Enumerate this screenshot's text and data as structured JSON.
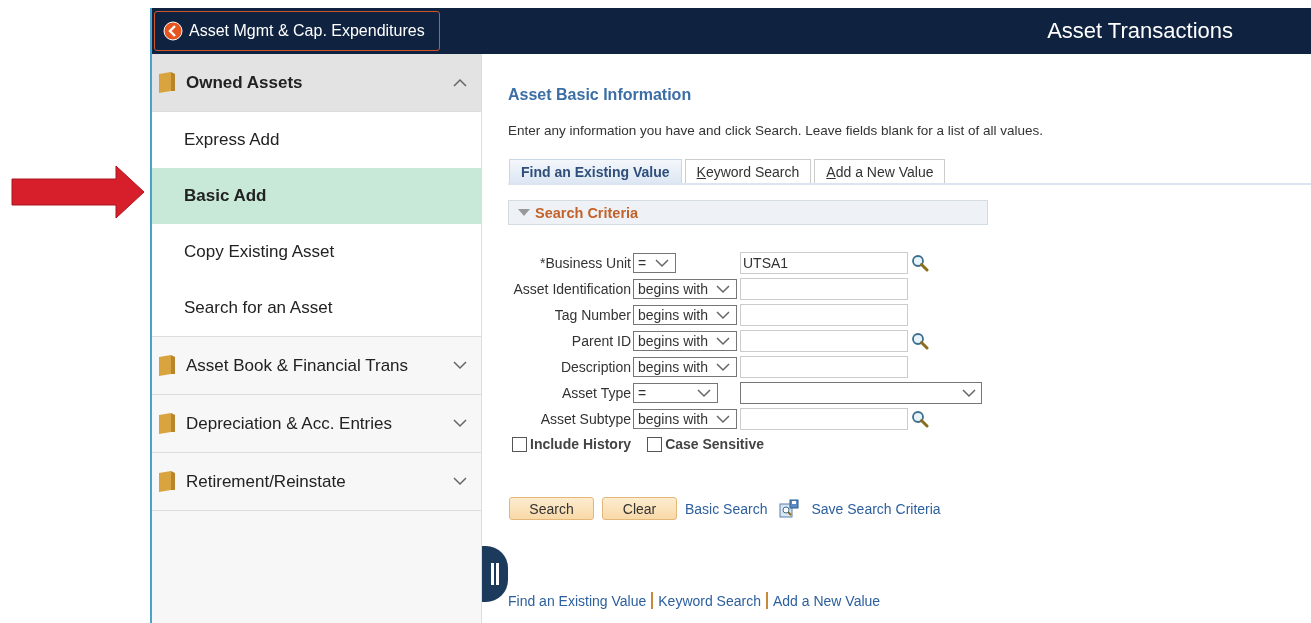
{
  "header": {
    "back_button": "Asset Mgmt & Cap. Expenditures",
    "title": "Asset Transactions"
  },
  "sidebar": {
    "groups": [
      {
        "label": "Owned Assets",
        "expanded": true,
        "items": [
          {
            "label": "Express Add",
            "selected": false
          },
          {
            "label": "Basic Add",
            "selected": true
          },
          {
            "label": "Copy Existing Asset",
            "selected": false
          },
          {
            "label": "Search for an Asset",
            "selected": false
          }
        ]
      },
      {
        "label": "Asset Book & Financial Trans",
        "expanded": false
      },
      {
        "label": "Depreciation & Acc. Entries",
        "expanded": false
      },
      {
        "label": "Retirement/Reinstate",
        "expanded": false
      }
    ]
  },
  "page": {
    "heading": "Asset Basic Information",
    "instructions": "Enter any information you have and click Search. Leave fields blank for a list of all values.",
    "tabs": [
      {
        "label": "Find an Existing Value",
        "selected": true
      },
      {
        "label": "Keyword Search",
        "selected": false
      },
      {
        "label": "Add a New Value",
        "selected": false
      }
    ],
    "section": {
      "title": "Search Criteria",
      "expanded": true
    },
    "fields": [
      {
        "label": "*Business Unit",
        "operator": "=",
        "kind": "text",
        "value": "UTSA1",
        "lookup": true
      },
      {
        "label": "Asset Identification",
        "operator": "begins with",
        "kind": "text",
        "lookup": false
      },
      {
        "label": "Tag Number",
        "operator": "begins with",
        "kind": "text",
        "lookup": false
      },
      {
        "label": "Parent ID",
        "operator": "begins with",
        "kind": "text",
        "lookup": true
      },
      {
        "label": "Description",
        "operator": "begins with",
        "kind": "text",
        "lookup": false
      },
      {
        "label": "Asset Type",
        "operator": "=",
        "kind": "dropdown",
        "lookup": false
      },
      {
        "label": "Asset Subtype",
        "operator": "begins with",
        "kind": "text",
        "lookup": true
      }
    ],
    "checkboxes": [
      {
        "label": "Include History",
        "checked": false
      },
      {
        "label": "Case Sensitive",
        "checked": false
      }
    ],
    "buttons": [
      "Search",
      "Clear"
    ],
    "links": [
      {
        "label": "Basic Search",
        "kind": "link"
      },
      {
        "label": "Save Search Criteria",
        "kind": "save"
      }
    ],
    "footer_links": [
      "Find an Existing Value",
      "Keyword Search",
      "Add a New Value"
    ]
  }
}
